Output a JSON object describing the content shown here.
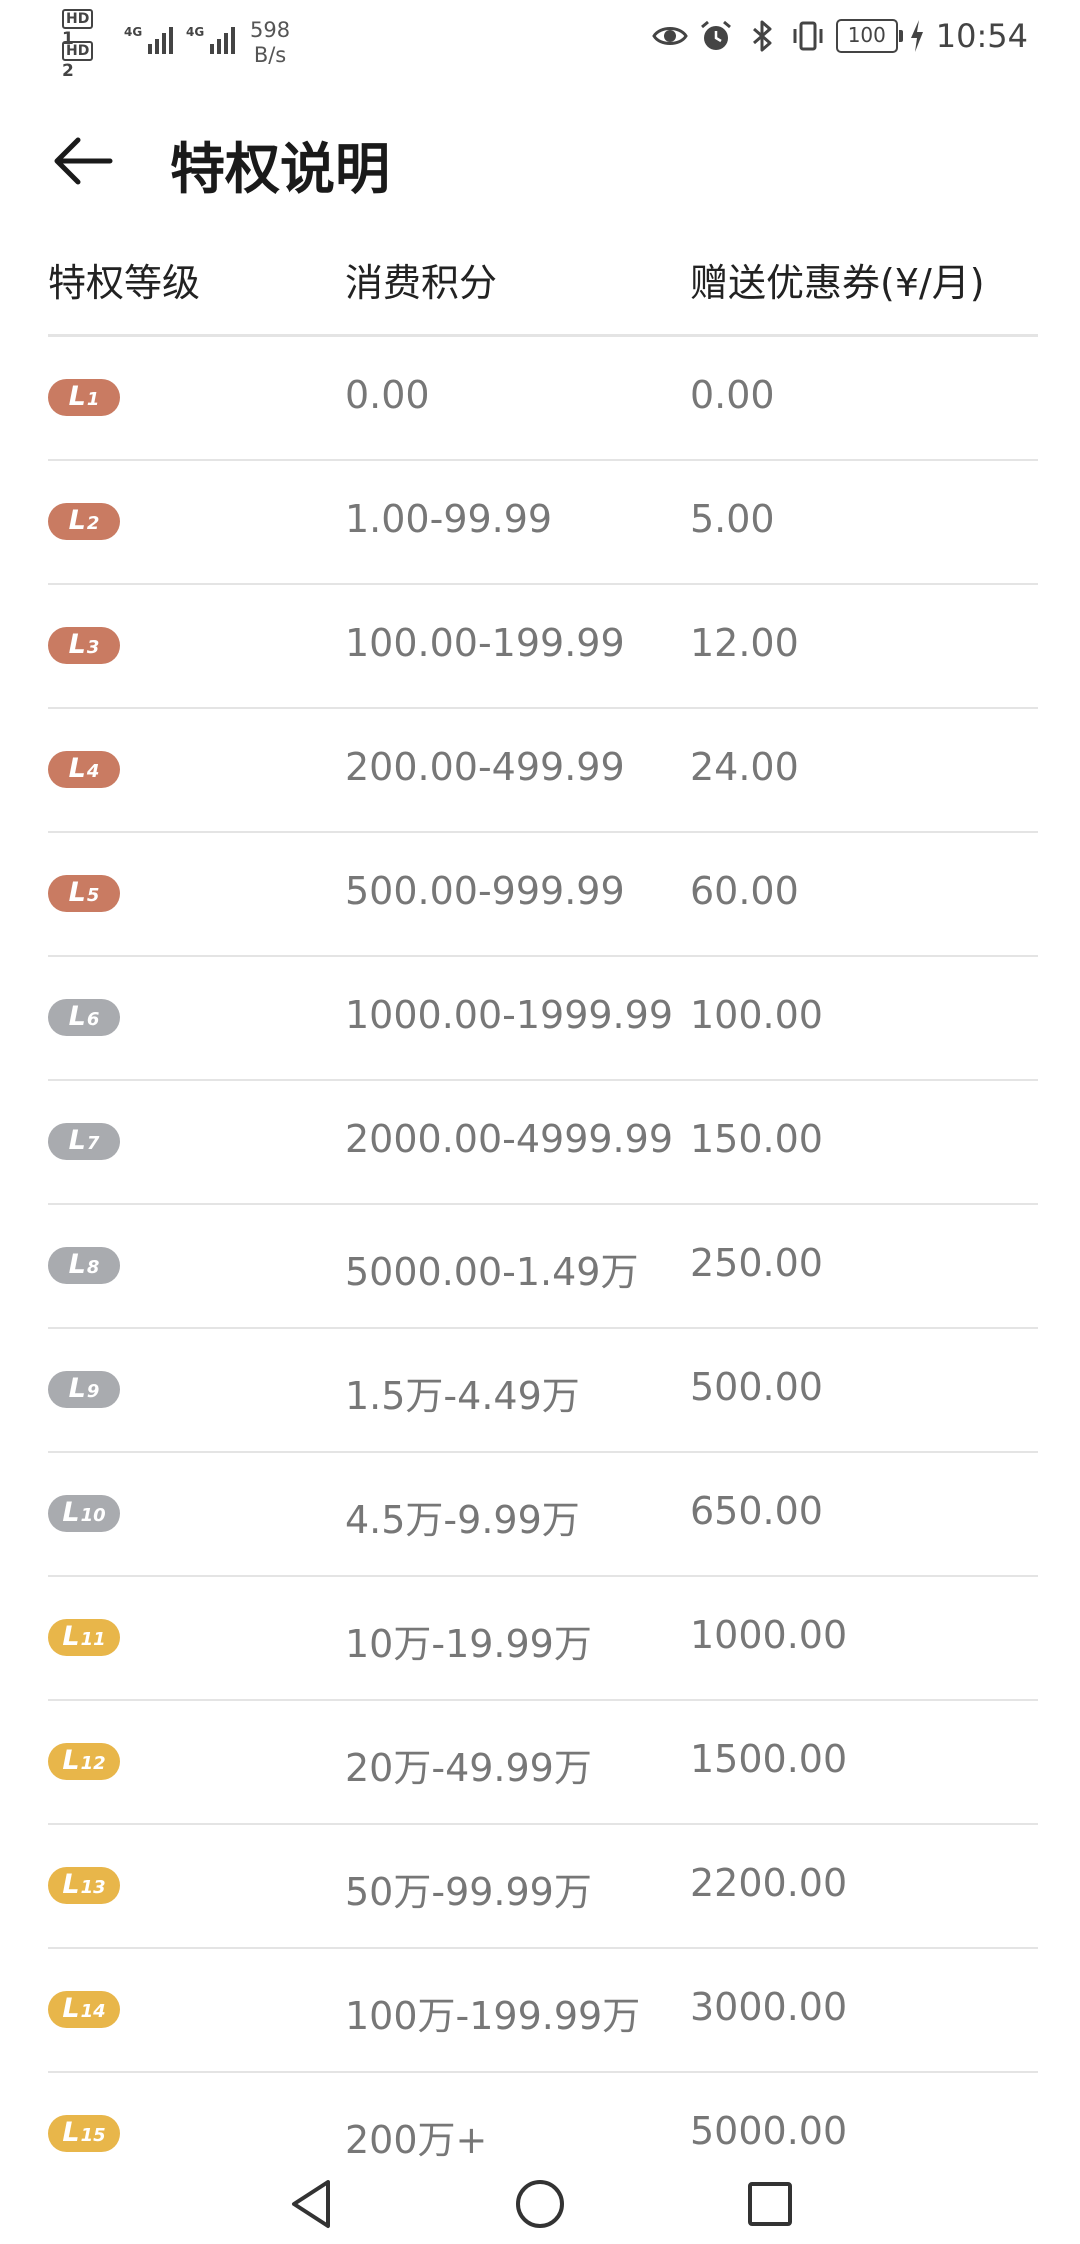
{
  "status_bar": {
    "sim1_label": "HD",
    "sim1_num": "1",
    "sim2_label": "HD",
    "sim2_num": "2",
    "net1": "4G",
    "net2": "4G",
    "speed_value": "598",
    "speed_unit": "B/s",
    "battery": "100",
    "time": "10:54",
    "icons": [
      "eye-icon",
      "alarm-icon",
      "bluetooth-icon",
      "vibrate-icon",
      "battery-icon",
      "charging-icon"
    ]
  },
  "header": {
    "title": "特权说明",
    "back_icon": "arrow-left-icon"
  },
  "table": {
    "headers": [
      "特权等级",
      "消费积分",
      "赠送优惠券(¥/月)"
    ],
    "rows": [
      {
        "level": "L",
        "num": "1",
        "color": "#c97b62",
        "points": "0.00",
        "coupon": "0.00"
      },
      {
        "level": "L",
        "num": "2",
        "color": "#c97b62",
        "points": "1.00-99.99",
        "coupon": "5.00"
      },
      {
        "level": "L",
        "num": "3",
        "color": "#c97b62",
        "points": "100.00-199.99",
        "coupon": "12.00"
      },
      {
        "level": "L",
        "num": "4",
        "color": "#c97b62",
        "points": "200.00-499.99",
        "coupon": "24.00"
      },
      {
        "level": "L",
        "num": "5",
        "color": "#c97b62",
        "points": "500.00-999.99",
        "coupon": "60.00"
      },
      {
        "level": "L",
        "num": "6",
        "color": "#a9abaf",
        "points": "1000.00-1999.99",
        "coupon": "100.00"
      },
      {
        "level": "L",
        "num": "7",
        "color": "#a9abaf",
        "points": "2000.00-4999.99",
        "coupon": "150.00"
      },
      {
        "level": "L",
        "num": "8",
        "color": "#a9abaf",
        "points": "5000.00-1.49万",
        "coupon": "250.00"
      },
      {
        "level": "L",
        "num": "9",
        "color": "#a9abaf",
        "points": "1.5万-4.49万",
        "coupon": "500.00"
      },
      {
        "level": "L",
        "num": "10",
        "color": "#a9abaf",
        "points": "4.5万-9.99万",
        "coupon": "650.00"
      },
      {
        "level": "L",
        "num": "11",
        "color": "#e8b64a",
        "points": "10万-19.99万",
        "coupon": "1000.00"
      },
      {
        "level": "L",
        "num": "12",
        "color": "#e8b64a",
        "points": "20万-49.99万",
        "coupon": "1500.00"
      },
      {
        "level": "L",
        "num": "13",
        "color": "#e8b64a",
        "points": "50万-99.99万",
        "coupon": "2200.00"
      },
      {
        "level": "L",
        "num": "14",
        "color": "#e8b64a",
        "points": "100万-199.99万",
        "coupon": "3000.00"
      },
      {
        "level": "L",
        "num": "15",
        "color": "#e8b64a",
        "points": "200万+",
        "coupon": "5000.00"
      }
    ]
  },
  "nav_bar": {
    "icons": [
      "nav-back-triangle-icon",
      "nav-home-circle-icon",
      "nav-recents-square-icon"
    ]
  }
}
